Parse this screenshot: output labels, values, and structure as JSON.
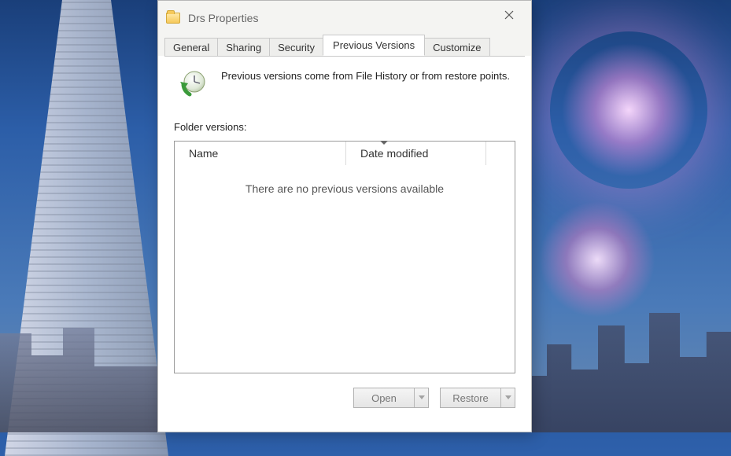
{
  "window": {
    "title": "Drs Properties"
  },
  "tabs": {
    "general": "General",
    "sharing": "Sharing",
    "security": "Security",
    "previous_versions": "Previous Versions",
    "customize": "Customize"
  },
  "info_text": "Previous versions come from File History or from restore points.",
  "section_label": "Folder versions:",
  "columns": {
    "name": "Name",
    "date_modified": "Date modified"
  },
  "empty_message": "There are no previous versions available",
  "buttons": {
    "open": "Open",
    "restore": "Restore"
  }
}
